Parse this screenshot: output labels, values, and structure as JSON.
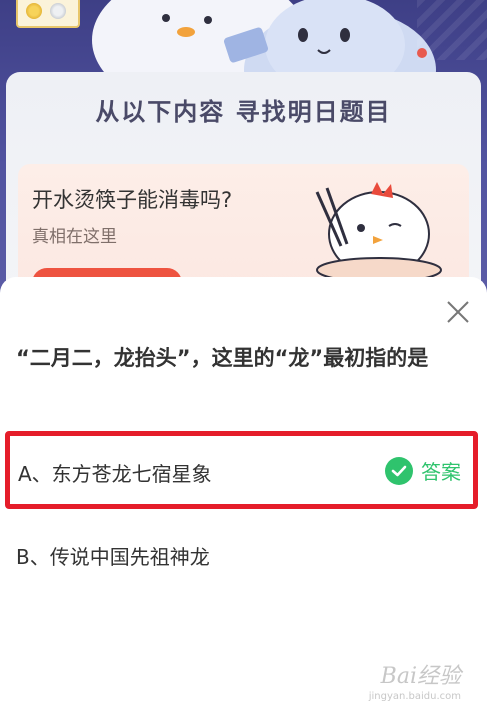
{
  "background": {
    "info_heading": "从以下内容 寻找明日题目",
    "article": {
      "title": "开水烫筷子能消毒吗?",
      "subtitle": "真相在这里"
    }
  },
  "quiz": {
    "question": "“二月二，龙抬头”，这里的“龙”最初指的是",
    "options": [
      {
        "label": "A、东方苍龙七宿星象",
        "is_answer": true
      },
      {
        "label": "B、传说中国先祖神龙",
        "is_answer": false
      }
    ],
    "answer_tag": "答案"
  },
  "watermark": {
    "brand": "Bai经验",
    "url": "jingyan.baidu.com"
  },
  "colors": {
    "highlight_border": "#e51d2a",
    "answer_green": "#2fc36d",
    "header_bg": "#4b4f93"
  }
}
